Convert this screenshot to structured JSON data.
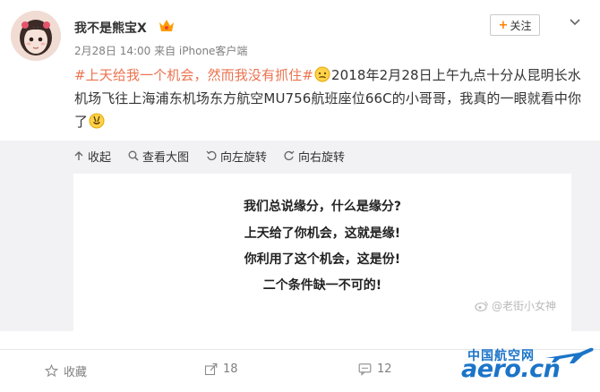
{
  "post": {
    "username": "我不是熊宝X",
    "meta": "2月28日 14:00 来自 iPhone客户端",
    "follow_label": "关注",
    "text_topic": "#上天给我一个机会，然而我没有抓住#",
    "text_body": "2018年2月28日上午九点十分从昆明长水机场飞往上海浦东机场东方航空MU756航班座位66C的小哥哥，我真的一眼就看中你了"
  },
  "media_toolbar": {
    "collapse": "收起",
    "view_large": "查看大图",
    "rotate_left": "向左旋转",
    "rotate_right": "向右旋转"
  },
  "image": {
    "lines": [
      "我们总说缘分，什么是缘分?",
      "上天给了你机会，这就是缘!",
      "你利用了这个机会，这是份!",
      "二个条件缺一不可的!"
    ],
    "watermark": "@老街小女神"
  },
  "actions": {
    "favorite": "收藏",
    "repost_count": "18",
    "comment_count": "12"
  },
  "site_logo": {
    "cn": "中国航空网",
    "en": "aero.cn"
  },
  "colors": {
    "topic": "#eb7350",
    "follow_plus": "#ff8200",
    "media_bg": "#f2f2f5",
    "logo_blue": "#1b74c8"
  }
}
